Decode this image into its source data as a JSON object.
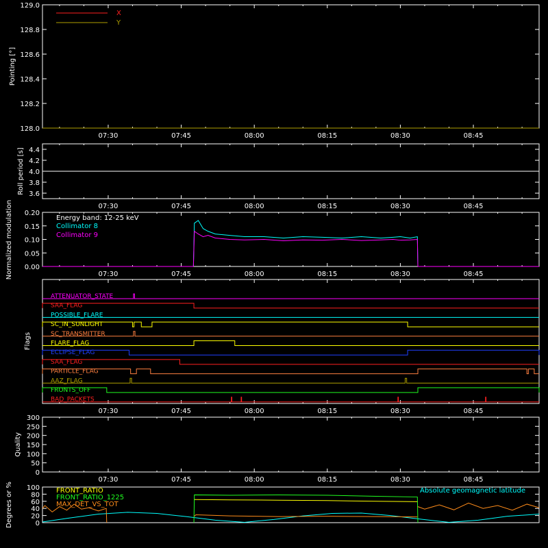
{
  "x_ticks": [
    "07:30",
    "07:45",
    "08:00",
    "08:15",
    "08:30",
    "08:45"
  ],
  "x_tick_minutes": [
    30,
    45,
    60,
    75,
    90,
    105
  ],
  "x_range_minutes": [
    16.5,
    118.5
  ],
  "chart_data": [
    {
      "type": "line",
      "id": "pointing",
      "ylabel": "Pointing [°]",
      "ylim": [
        128.0,
        129.0
      ],
      "yticks": [
        "128.0",
        "128.2",
        "128.4",
        "128.6",
        "128.8",
        "129.0"
      ],
      "ytick_values": [
        128.0,
        128.2,
        128.4,
        128.6,
        128.8,
        129.0
      ],
      "legend": [
        {
          "name": "X",
          "color": "#ff2020"
        },
        {
          "name": "Y",
          "color": "#b0a000"
        }
      ],
      "series": [
        {
          "name": "X",
          "color": "#ff2020",
          "x": [],
          "y": []
        },
        {
          "name": "Y",
          "color": "#b0a000",
          "x": [
            16.5,
            118.5
          ],
          "y": [
            128.0,
            128.0
          ]
        }
      ]
    },
    {
      "type": "line",
      "id": "roll",
      "ylabel": "Roll period [s]",
      "ylim": [
        3.5,
        4.5
      ],
      "yticks": [
        "3.6",
        "3.8",
        "4.0",
        "4.2",
        "4.4"
      ],
      "ytick_values": [
        3.6,
        3.8,
        4.0,
        4.2,
        4.4
      ],
      "series": [
        {
          "name": "",
          "color": "#ffffff",
          "x": [
            16.5,
            118.5
          ],
          "y": [
            4.0,
            4.0
          ]
        }
      ]
    },
    {
      "type": "line",
      "id": "modulation",
      "ylabel": "Normalized modulation",
      "ylim": [
        0.0,
        0.2
      ],
      "yticks": [
        "0.00",
        "0.05",
        "0.10",
        "0.15",
        "0.20"
      ],
      "ytick_values": [
        0.0,
        0.05,
        0.1,
        0.15,
        0.2
      ],
      "annotation": "Energy band: 12-25 keV",
      "legend": [
        {
          "name": "Collimator 8",
          "color": "#00ffff"
        },
        {
          "name": "Collimator 9",
          "color": "#ff00ff"
        }
      ],
      "series": [
        {
          "name": "Collimator 8",
          "color": "#00ffff",
          "segments": [
            {
              "x": [
                47.5,
                47.7,
                48.5,
                49.5,
                50.5,
                52,
                55,
                58,
                62,
                66,
                70,
                74,
                78,
                82,
                86,
                88.5,
                90,
                92,
                93.5,
                93.6
              ],
              "y": [
                0.0,
                0.16,
                0.17,
                0.14,
                0.13,
                0.12,
                0.115,
                0.11,
                0.11,
                0.105,
                0.11,
                0.108,
                0.105,
                0.11,
                0.105,
                0.108,
                0.11,
                0.105,
                0.11,
                0.0
              ]
            }
          ]
        },
        {
          "name": "Collimator 9",
          "color": "#ff00ff",
          "segments": [
            {
              "x": [
                16.5,
                47.5
              ],
              "y": [
                0.0,
                0.0
              ]
            },
            {
              "x": [
                47.5,
                47.7,
                48.5,
                49.5,
                50.5,
                52,
                55,
                58,
                62,
                66,
                70,
                74,
                78,
                82,
                86,
                88.5,
                90,
                92,
                93.5,
                93.6
              ],
              "y": [
                0.0,
                0.13,
                0.12,
                0.11,
                0.115,
                0.105,
                0.1,
                0.098,
                0.1,
                0.095,
                0.098,
                0.097,
                0.1,
                0.096,
                0.098,
                0.1,
                0.097,
                0.098,
                0.1,
                0.0
              ]
            },
            {
              "x": [
                93.6,
                118.5
              ],
              "y": [
                0.0,
                0.0
              ]
            }
          ]
        }
      ]
    },
    {
      "type": "line",
      "id": "flags",
      "ylabel": "Flags",
      "flags": [
        {
          "name": "ATTENUATOR_STATE",
          "color": "#ff00ff",
          "pulses": [
            [
              35.2,
              35.4
            ]
          ]
        },
        {
          "name": "SAA_FLAG",
          "color": "#ff2020",
          "pulses": [
            [
              16.5,
              47.6
            ]
          ]
        },
        {
          "name": "POSSIBLE_FLARE",
          "color": "#00ffff",
          "pulses": []
        },
        {
          "name": "SC_IN_SUNLIGHT",
          "color": "#ffff00",
          "pulses": [
            [
              16.5,
              35.0
            ],
            [
              35.3,
              36.8
            ],
            [
              39.0,
              91.5
            ]
          ]
        },
        {
          "name": "SC_TRANSMITTER",
          "color": "#ff8040",
          "pulses": [
            [
              35.2,
              35.5
            ]
          ]
        },
        {
          "name": "FLARE_FLAG",
          "color": "#ffff00",
          "pulses": [
            [
              47.6,
              56.0
            ]
          ]
        },
        {
          "name": "ECLIPSE_FLAG",
          "color": "#2040ff",
          "pulses": [
            [
              16.5,
              34.3
            ],
            [
              91.5,
              118.5
            ]
          ]
        },
        {
          "name": "SAA_FLAG",
          "color": "#ff2020",
          "pulses": [
            [
              16.5,
              44.7
            ]
          ]
        },
        {
          "name": "PARTICLE_FLAG",
          "color": "#ff8040",
          "pulses": [
            [
              16.5,
              34.6
            ],
            [
              35.8,
              38.7
            ],
            [
              93.6,
              116.0
            ],
            [
              116.3,
              117.5
            ]
          ]
        },
        {
          "name": "AAZ_FLAG",
          "color": "#b0a000",
          "pulses": [
            [
              34.5,
              34.8
            ],
            [
              91.0,
              91.3
            ]
          ]
        },
        {
          "name": "FRONTS_OFF",
          "color": "#20ff20",
          "pulses": [
            [
              16.5,
              29.7
            ],
            [
              93.6,
              118.5
            ]
          ]
        },
        {
          "name": "BAD_PACKETS",
          "color": "#ff2020",
          "pulses": [
            [
              55.3,
              55.4
            ],
            [
              57.3,
              57.4
            ],
            [
              89.5,
              89.6
            ],
            [
              107.5,
              107.6
            ]
          ]
        }
      ]
    },
    {
      "type": "line",
      "id": "quality",
      "ylabel": "Quality",
      "ylim": [
        0,
        300
      ],
      "yticks": [
        "0",
        "50",
        "100",
        "150",
        "200",
        "250",
        "300"
      ],
      "ytick_values": [
        0,
        50,
        100,
        150,
        200,
        250,
        300
      ],
      "series": []
    },
    {
      "type": "line",
      "id": "ratios",
      "ylabel": "Degrees or %",
      "ylim": [
        0,
        100
      ],
      "yticks": [
        "0",
        "20",
        "40",
        "60",
        "80",
        "100"
      ],
      "ytick_values": [
        0,
        20,
        40,
        60,
        80,
        100
      ],
      "legend": [
        {
          "name": "FRONT_RATIO",
          "color": "#ffff00"
        },
        {
          "name": "FRONT_RATIO_1225",
          "color": "#20ff20"
        },
        {
          "name": "MAX_DET_VS_TOT",
          "color": "#ff8c1a"
        }
      ],
      "annotation_right": {
        "text": "Absolute geomagnetic latitude",
        "color": "#00ffff"
      },
      "series": [
        {
          "name": "Absolute geomagnetic latitude",
          "color": "#00ffff",
          "x": [
            16.5,
            22,
            28,
            34,
            40,
            46,
            52,
            58,
            64,
            70,
            76,
            82,
            88,
            94,
            100,
            106,
            112,
            118.5
          ],
          "y": [
            2,
            13,
            24,
            29,
            26,
            17,
            7,
            1,
            9,
            19,
            26,
            27,
            20,
            10,
            1,
            7,
            18,
            24
          ]
        },
        {
          "name": "FRONT_RATIO_1225",
          "color": "#20ff20",
          "segments": [
            {
              "x": [
                47.6,
                47.7,
                55,
                65,
                75,
                85,
                93.5,
                93.6
              ],
              "y": [
                0,
                78,
                77,
                78,
                77,
                74,
                72,
                0
              ]
            }
          ]
        },
        {
          "name": "FRONT_RATIO",
          "color": "#ffff00",
          "segments": [
            {
              "x": [
                47.7,
                55,
                65,
                75,
                85,
                93.5
              ],
              "y": [
                65,
                64,
                63,
                62,
                60,
                59
              ]
            }
          ]
        },
        {
          "name": "MAX_DET_VS_TOT",
          "color": "#ff8c1a",
          "segments": [
            {
              "x": [
                16.5,
                17,
                18.5,
                20,
                21.5,
                23,
                24.5,
                26,
                28,
                29.6,
                29.7
              ],
              "y": [
                40,
                48,
                30,
                45,
                35,
                52,
                38,
                42,
                33,
                40,
                0
              ]
            },
            {
              "x": [
                47.7,
                48,
                55,
                65,
                75,
                85,
                93.5
              ],
              "y": [
                18,
                22,
                19,
                17,
                18,
                17,
                16
              ]
            },
            {
              "x": [
                93.6,
                95,
                98,
                101,
                104,
                107,
                110,
                113,
                116,
                118.5
              ],
              "y": [
                45,
                38,
                50,
                36,
                55,
                40,
                48,
                35,
                52,
                42
              ]
            }
          ]
        }
      ]
    }
  ]
}
